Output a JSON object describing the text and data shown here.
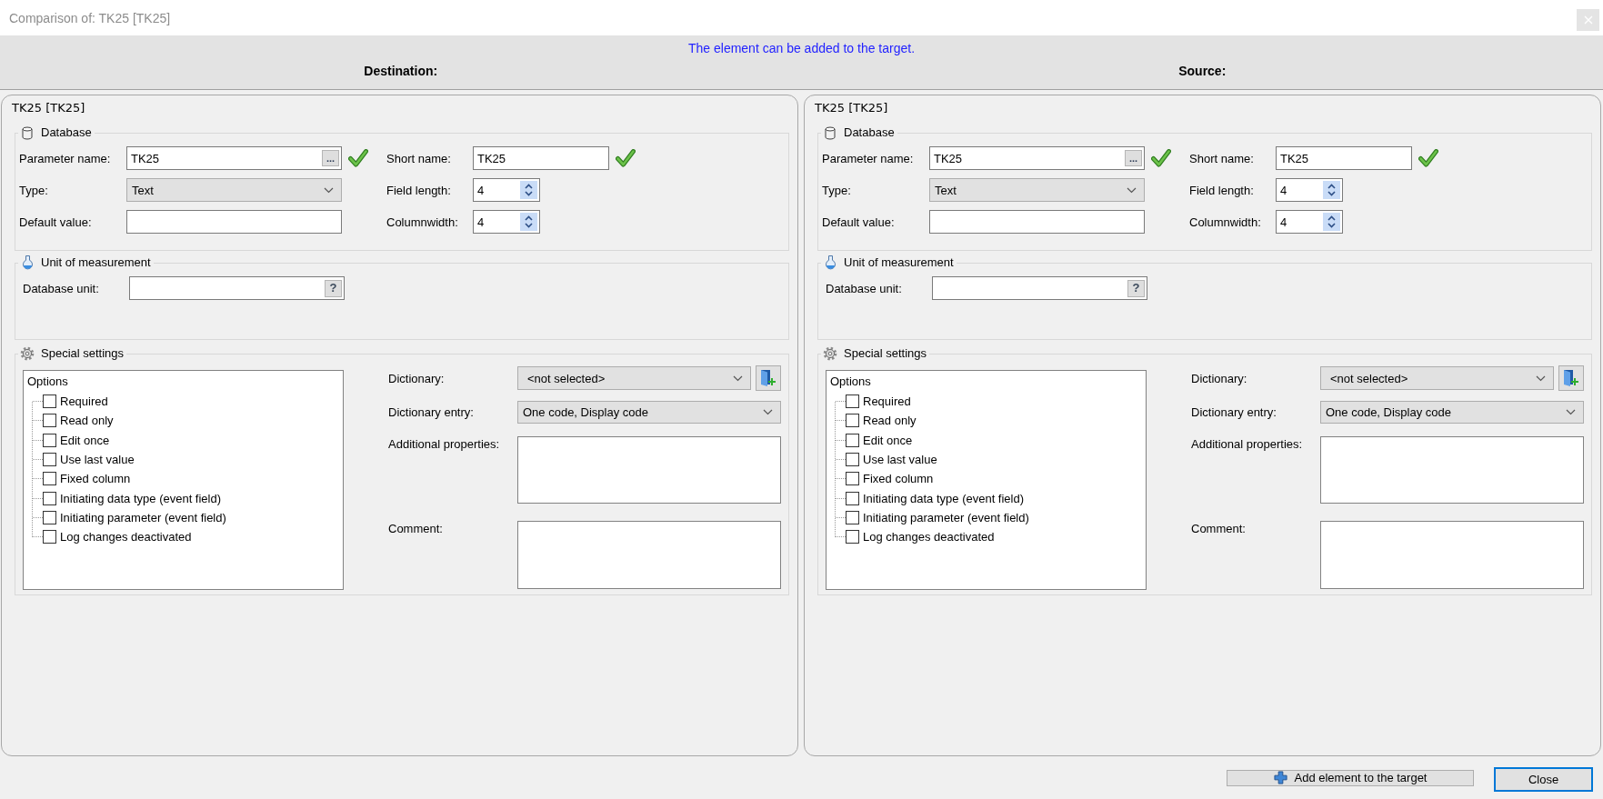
{
  "window": {
    "title": "Comparison of: TK25 [TK25]"
  },
  "header": {
    "message": "The element can be added to the target.",
    "columns": [
      "Destination:",
      "Source:"
    ]
  },
  "panels": [
    {
      "title": "TK25 [TK25]",
      "database": {
        "title": "Database",
        "parameter_name": {
          "label": "Parameter name:",
          "value": "TK25",
          "button": "...",
          "valid": true
        },
        "short_name": {
          "label": "Short name:",
          "value": "TK25",
          "valid": true
        },
        "type": {
          "label": "Type:",
          "value": "Text"
        },
        "field_length": {
          "label": "Field length:",
          "value": "4"
        },
        "default_value": {
          "label": "Default value:"
        },
        "columnwidth": {
          "label": "Columnwidth:",
          "value": "4"
        }
      },
      "unit": {
        "title": "Unit of measurement",
        "database_unit": {
          "label": "Database unit:",
          "button": "?"
        }
      },
      "special": {
        "title": "Special settings",
        "options": {
          "title": "Options",
          "items": [
            {
              "label": "Required",
              "checked": false
            },
            {
              "label": "Read only",
              "checked": false
            },
            {
              "label": "Edit once",
              "checked": false
            },
            {
              "label": "Use last value",
              "checked": false
            },
            {
              "label": "Fixed column",
              "checked": false
            },
            {
              "label": "Initiating data type (event field)",
              "checked": false
            },
            {
              "label": "Initiating parameter (event field)",
              "checked": false
            },
            {
              "label": "Log changes deactivated",
              "checked": false
            }
          ]
        },
        "dictionary": {
          "label": "Dictionary:",
          "value": "<not selected>"
        },
        "dictionary_entry": {
          "label": "Dictionary entry:",
          "value": "One code, Display code"
        },
        "additional_properties": {
          "label": "Additional properties:"
        },
        "comment": {
          "label": "Comment:"
        }
      }
    },
    {
      "title": "TK25 [TK25]",
      "database": {
        "title": "Database",
        "parameter_name": {
          "label": "Parameter name:",
          "value": "TK25",
          "button": "...",
          "valid": true
        },
        "short_name": {
          "label": "Short name:",
          "value": "TK25",
          "valid": true
        },
        "type": {
          "label": "Type:",
          "value": "Text"
        },
        "field_length": {
          "label": "Field length:",
          "value": "4"
        },
        "default_value": {
          "label": "Default value:"
        },
        "columnwidth": {
          "label": "Columnwidth:",
          "value": "4"
        }
      },
      "unit": {
        "title": "Unit of measurement",
        "database_unit": {
          "label": "Database unit:",
          "button": "?"
        }
      },
      "special": {
        "title": "Special settings",
        "options": {
          "title": "Options",
          "items": [
            {
              "label": "Required",
              "checked": false
            },
            {
              "label": "Read only",
              "checked": false
            },
            {
              "label": "Edit once",
              "checked": false
            },
            {
              "label": "Use last value",
              "checked": false
            },
            {
              "label": "Fixed column",
              "checked": false
            },
            {
              "label": "Initiating data type (event field)",
              "checked": false
            },
            {
              "label": "Initiating parameter (event field)",
              "checked": false
            },
            {
              "label": "Log changes deactivated",
              "checked": false
            }
          ]
        },
        "dictionary": {
          "label": "Dictionary:",
          "value": "<not selected>"
        },
        "dictionary_entry": {
          "label": "Dictionary entry:",
          "value": "One code, Display code"
        },
        "additional_properties": {
          "label": "Additional properties:"
        },
        "comment": {
          "label": "Comment:"
        }
      }
    }
  ],
  "buttons": [
    {
      "label": "Add element to the target",
      "kind": "add",
      "focused": false
    },
    {
      "label": "Close",
      "kind": "plain",
      "focused": true
    }
  ]
}
